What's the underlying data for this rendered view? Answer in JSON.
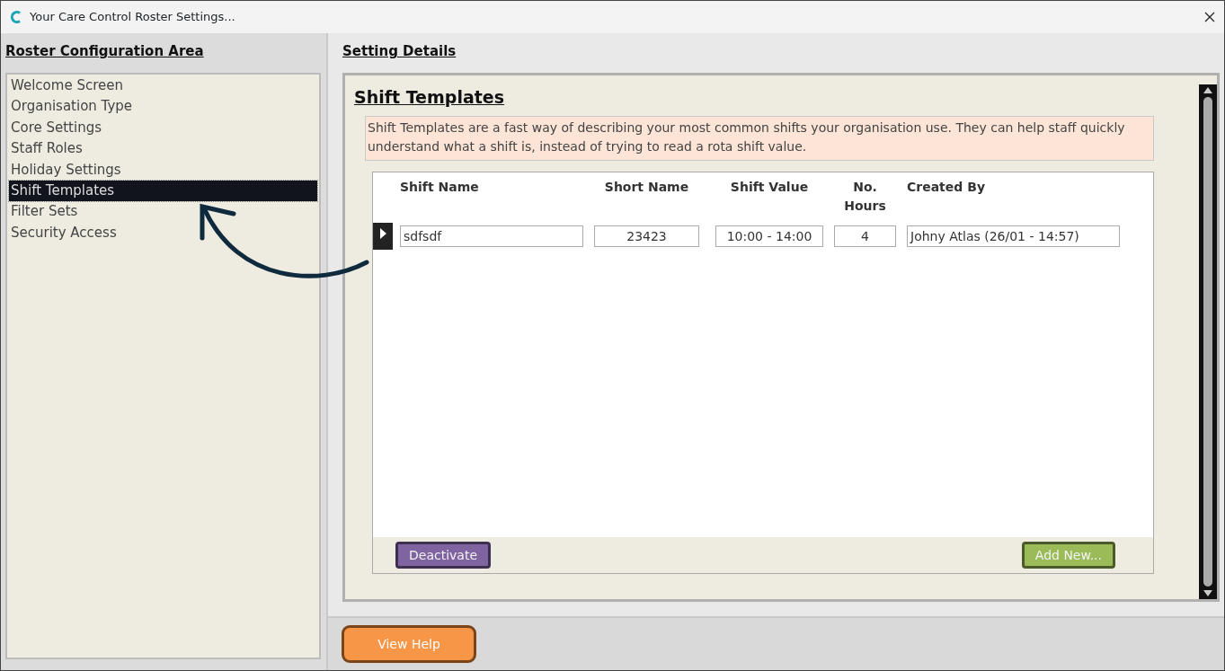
{
  "window": {
    "title": "Your Care Control Roster Settings..."
  },
  "sidebar": {
    "heading": "Roster Configuration Area",
    "items": [
      {
        "label": "Welcome Screen",
        "selected": false
      },
      {
        "label": "Organisation Type",
        "selected": false
      },
      {
        "label": "Core Settings",
        "selected": false
      },
      {
        "label": "Staff Roles",
        "selected": false
      },
      {
        "label": "Holiday Settings",
        "selected": false
      },
      {
        "label": "Shift Templates",
        "selected": true
      },
      {
        "label": "Filter Sets",
        "selected": false
      },
      {
        "label": "Security Access",
        "selected": false
      }
    ]
  },
  "details": {
    "heading": "Setting Details",
    "title": "Shift Templates",
    "description": "Shift Templates are a fast way of describing your most common shifts your organisation use.  They can help staff quickly understand what a shift is, instead of trying to read a rota shift value.",
    "table": {
      "columns": [
        "Shift Name",
        "Short Name",
        "Shift Value",
        "No. Hours",
        "Created By"
      ],
      "rows": [
        {
          "selected": true,
          "cells": [
            "sdfsdf",
            "23423",
            "10:00 - 14:00",
            "4",
            "Johny Atlas (26/01 - 14:57)"
          ]
        }
      ]
    },
    "buttons": [
      {
        "label": "Deactivate",
        "kind": "deactivate"
      },
      {
        "label": "Add New...",
        "kind": "add"
      }
    ]
  },
  "footer": {
    "help_button": "View Help"
  }
}
